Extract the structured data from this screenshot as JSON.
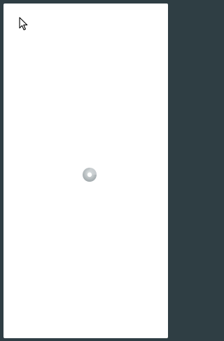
{
  "window": {
    "state": "loading"
  },
  "cursor": {
    "icon": "arrow-pointer-icon"
  },
  "loading_indicator": {
    "icon": "spinner-icon"
  },
  "colors": {
    "desktop_background": "#2f3e44",
    "window_background": "#ffffff",
    "spinner_ring": "#b8bec0",
    "spinner_core": "#ffffff"
  }
}
